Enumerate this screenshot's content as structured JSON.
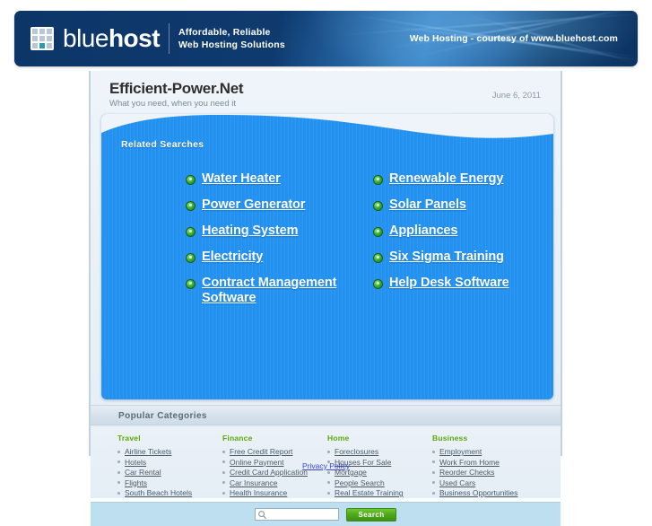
{
  "banner": {
    "logo_text_light": "blue",
    "logo_text_bold": "host",
    "tagline_line1": "Affordable, Reliable",
    "tagline_line2": "Web Hosting Solutions",
    "right_text": "Web Hosting - courtesy of www.bluehost.com",
    "bg_color": "#0d3668",
    "accent_cell_color": "#2e9aa8"
  },
  "page": {
    "site_title": "Efficient-Power.Net",
    "site_subtitle": "What you need, when you need it",
    "date": "June 6, 2011",
    "panel_bg": "#eef4fa"
  },
  "related_searches": {
    "label": "Related Searches",
    "box_color": "#2391f0",
    "links": [
      "Water Heater",
      "Renewable Energy",
      "Power Generator",
      "Solar Panels",
      "Heating System",
      "Appliances",
      "Electricity",
      "Six Sigma Training",
      "Contract Management Software",
      "Help Desk Software"
    ]
  },
  "popular_categories": {
    "title": "Popular Categories",
    "heading_color": "#5aa908",
    "columns": [
      {
        "name": "Travel",
        "links": [
          "Airline Tickets",
          "Hotels",
          "Car Rental",
          "Flights",
          "South Beach Hotels"
        ]
      },
      {
        "name": "Finance",
        "links": [
          "Free Credit Report",
          "Online Payment",
          "Credit Card Application",
          "Car Insurance",
          "Health Insurance"
        ]
      },
      {
        "name": "Home",
        "links": [
          "Foreclosures",
          "Houses For Sale",
          "Mortgage",
          "People Search",
          "Real Estate Training"
        ]
      },
      {
        "name": "Business",
        "links": [
          "Employment",
          "Work From Home",
          "Reorder Checks",
          "Used Cars",
          "Business Opportunities"
        ]
      }
    ]
  },
  "search": {
    "value": "",
    "placeholder": "",
    "button_label": "Search",
    "button_color": "#4fa81b",
    "strip_color": "#bedff0"
  },
  "footer": {
    "privacy_label": "Privacy Policy",
    "link_color": "#3b43d6"
  }
}
